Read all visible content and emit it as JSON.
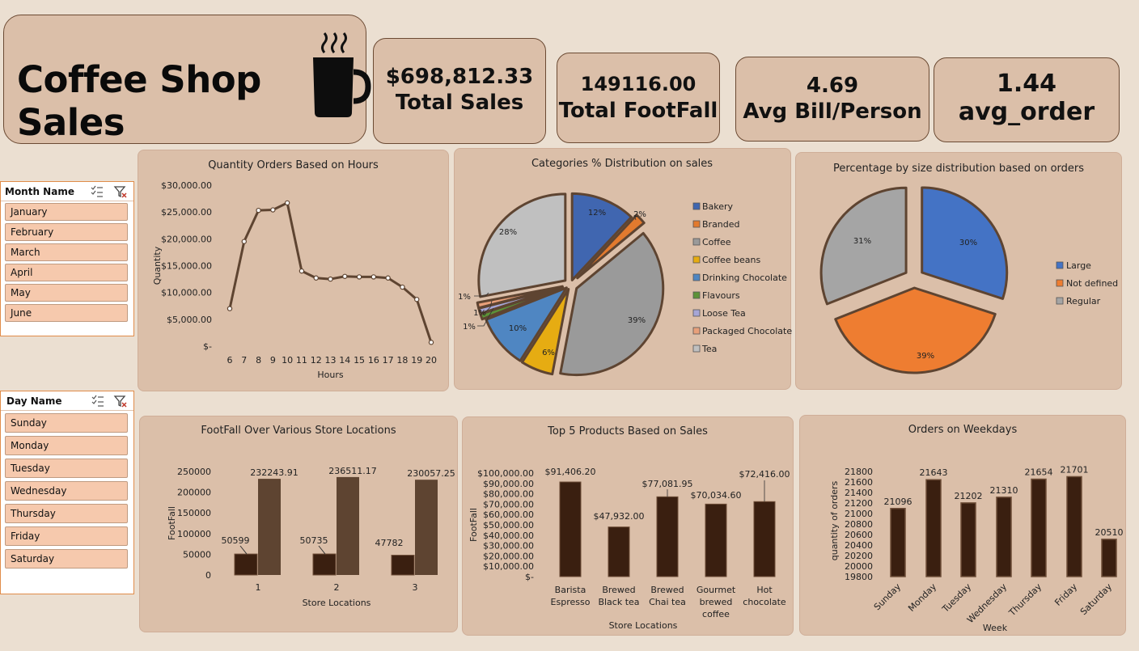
{
  "header": {
    "title": "Coffee Shop Sales",
    "mug_icon": "coffee-mug-icon"
  },
  "kpis": [
    {
      "value": "$698,812.33",
      "label": "Total Sales"
    },
    {
      "value": "149116.00",
      "label": "Total FootFall"
    },
    {
      "value": "4.69",
      "label": "Avg Bill/Person"
    },
    {
      "value": "1.44",
      "label": "avg_order"
    }
  ],
  "slicers": {
    "month": {
      "title": "Month Name",
      "items": [
        "January",
        "February",
        "March",
        "April",
        "May",
        "June"
      ]
    },
    "day": {
      "title": "Day Name",
      "items": [
        "Sunday",
        "Monday",
        "Tuesday",
        "Wednesday",
        "Thursday",
        "Friday",
        "Saturday"
      ]
    }
  },
  "colors": {
    "brown_line": "#5e4431",
    "dark_bar": "#3a1f10",
    "mid_bar": "#5e4431",
    "panel": "#dbbfa9",
    "slicer_item": "#f6c9ad"
  },
  "chart_data": [
    {
      "type": "line",
      "title": "Quantity Orders Based on Hours",
      "xlabel": "Hours",
      "ylabel": "Quantity",
      "x": [
        6,
        7,
        8,
        9,
        10,
        11,
        12,
        13,
        14,
        15,
        16,
        17,
        18,
        19,
        20
      ],
      "values": [
        7000,
        19500,
        25300,
        25400,
        26700,
        14000,
        12700,
        12500,
        13000,
        12900,
        12900,
        12700,
        11000,
        8700,
        700
      ],
      "ylim": [
        0,
        30000
      ],
      "ytick_labels": [
        "$-",
        "$5,000.00",
        "$10,000.00",
        "$15,000.00",
        "$20,000.00",
        "$25,000.00",
        "$30,000.00"
      ]
    },
    {
      "type": "pie",
      "title": "Categories % Distribution on sales",
      "legend_position": "right",
      "labels": [
        "Bakery",
        "Branded",
        "Coffee",
        "Coffee beans",
        "Drinking Chocolate",
        "Flavours",
        "Loose Tea",
        "Packaged Chocolate",
        "Tea"
      ],
      "values": [
        12,
        2,
        39,
        6,
        10,
        1,
        1,
        1,
        28
      ],
      "value_labels": [
        "12%",
        "2%",
        "39%",
        "6%",
        "10%",
        "1%",
        "1%",
        "1%",
        "28%"
      ],
      "colors": [
        "#4066b0",
        "#e27a2e",
        "#9a9a9a",
        "#e6ac12",
        "#4f86c2",
        "#5c9238",
        "#a6a6d6",
        "#e8a07a",
        "#c0c0c0"
      ]
    },
    {
      "type": "pie",
      "title": "Percentage by size distribution based on orders",
      "legend_position": "right",
      "labels": [
        "Large",
        "Not defined",
        "Regular"
      ],
      "values": [
        30,
        39,
        31
      ],
      "value_labels": [
        "30%",
        "39%",
        "31%"
      ],
      "colors": [
        "#4473c5",
        "#ee7d31",
        "#a5a5a5"
      ]
    },
    {
      "type": "bar",
      "title": "FootFall Over Various Store Locations",
      "xlabel": "Store Locations",
      "ylabel": "FootFall",
      "categories": [
        "1",
        "2",
        "3"
      ],
      "series": [
        {
          "values": [
            50599,
            50735,
            47782
          ],
          "labels": [
            "50599",
            "50735",
            "47782"
          ]
        },
        {
          "values": [
            232243.91,
            236511.17,
            230057.25
          ],
          "labels": [
            "232243.91",
            "236511.17",
            "230057.25"
          ]
        }
      ],
      "ylim": [
        0,
        250000
      ],
      "ytick_labels": [
        "0",
        "50000",
        "100000",
        "150000",
        "200000",
        "250000"
      ]
    },
    {
      "type": "bar",
      "title": "Top 5 Products Based on Sales",
      "xlabel": "Store Locations",
      "ylabel": "FootFall",
      "categories": [
        "Barista Espresso",
        "Brewed Black tea",
        "Brewed Chai tea",
        "Gourmet brewed coffee",
        "Hot chocolate"
      ],
      "category_lines": [
        [
          "Barista",
          "Espresso"
        ],
        [
          "Brewed",
          "Black tea"
        ],
        [
          "Brewed",
          "Chai tea"
        ],
        [
          "Gourmet",
          "brewed",
          "coffee"
        ],
        [
          "Hot",
          "chocolate"
        ]
      ],
      "values": [
        91406.2,
        47932.0,
        77081.95,
        70034.6,
        72416.0
      ],
      "value_labels": [
        "$91,406.20",
        "$47,932.00",
        "$77,081.95",
        "$70,034.60",
        "$72,416.00"
      ],
      "ylim": [
        0,
        100000
      ],
      "ytick_labels": [
        "$-",
        "$10,000.00",
        "$20,000.00",
        "$30,000.00",
        "$40,000.00",
        "$50,000.00",
        "$60,000.00",
        "$70,000.00",
        "$80,000.00",
        "$90,000.00",
        "$100,000.00"
      ]
    },
    {
      "type": "bar",
      "title": "Orders on Weekdays",
      "xlabel": "Week",
      "ylabel": "quantity of orders",
      "categories": [
        "Sunday",
        "Monday",
        "Tuesday",
        "Wednesday",
        "Thursday",
        "Friday",
        "Saturday"
      ],
      "values": [
        21096,
        21643,
        21202,
        21310,
        21654,
        21701,
        20510
      ],
      "value_labels": [
        "21096",
        "21643",
        "21202",
        "21310",
        "21654",
        "21701",
        "20510"
      ],
      "ylim": [
        19800,
        21800
      ],
      "ytick_labels": [
        "19800",
        "20000",
        "20200",
        "20400",
        "20600",
        "20800",
        "21000",
        "21200",
        "21400",
        "21600",
        "21800"
      ]
    }
  ]
}
